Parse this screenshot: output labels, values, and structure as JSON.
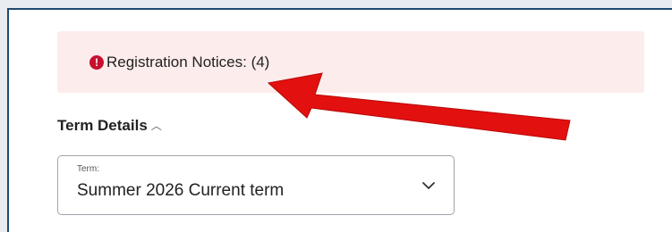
{
  "notices": {
    "icon": "alert-circle-icon",
    "label": "Registration Notices: (4)",
    "background": "#fdecec",
    "icon_color": "#c8102e"
  },
  "term_section": {
    "heading": "Term Details",
    "toggle_icon": "chevron-up-icon"
  },
  "term_select": {
    "label": "Term:",
    "value": "Summer 2026 Current term",
    "icon": "chevron-down-icon"
  },
  "annotation": {
    "icon": "red-arrow-annotation",
    "color": "#e31010"
  }
}
